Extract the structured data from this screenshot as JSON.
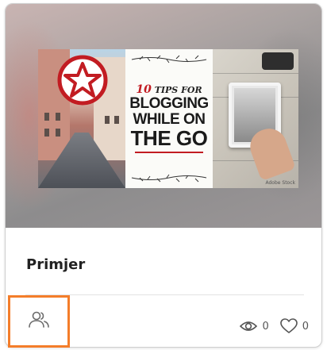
{
  "card": {
    "title": "Primjer",
    "thumbnail": {
      "headline_prefix": "TIPS FOR",
      "headline_number": "10",
      "headline_line2": "BLOGGING",
      "headline_line3": "WHILE ON",
      "headline_line4": "THE GO",
      "watermark": "Adobe Stock"
    },
    "stats": {
      "views": "0",
      "likes": "0"
    },
    "icons": {
      "share": "people-icon",
      "views": "eye-icon",
      "likes": "heart-icon"
    },
    "colors": {
      "highlight": "#f47d2a",
      "accent_red": "#c21c22"
    }
  }
}
